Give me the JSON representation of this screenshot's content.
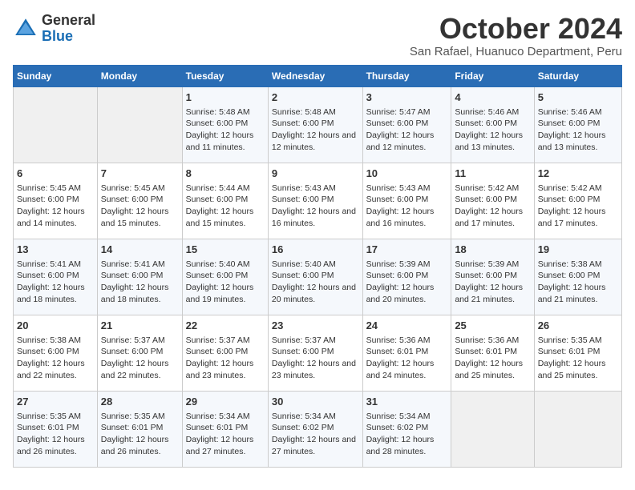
{
  "logo": {
    "general": "General",
    "blue": "Blue"
  },
  "title": "October 2024",
  "subtitle": "San Rafael, Huanuco Department, Peru",
  "days_of_week": [
    "Sunday",
    "Monday",
    "Tuesday",
    "Wednesday",
    "Thursday",
    "Friday",
    "Saturday"
  ],
  "weeks": [
    [
      {
        "day": "",
        "sunrise": "",
        "sunset": "",
        "daylight": ""
      },
      {
        "day": "",
        "sunrise": "",
        "sunset": "",
        "daylight": ""
      },
      {
        "day": "1",
        "sunrise": "Sunrise: 5:48 AM",
        "sunset": "Sunset: 6:00 PM",
        "daylight": "Daylight: 12 hours and 11 minutes."
      },
      {
        "day": "2",
        "sunrise": "Sunrise: 5:48 AM",
        "sunset": "Sunset: 6:00 PM",
        "daylight": "Daylight: 12 hours and 12 minutes."
      },
      {
        "day": "3",
        "sunrise": "Sunrise: 5:47 AM",
        "sunset": "Sunset: 6:00 PM",
        "daylight": "Daylight: 12 hours and 12 minutes."
      },
      {
        "day": "4",
        "sunrise": "Sunrise: 5:46 AM",
        "sunset": "Sunset: 6:00 PM",
        "daylight": "Daylight: 12 hours and 13 minutes."
      },
      {
        "day": "5",
        "sunrise": "Sunrise: 5:46 AM",
        "sunset": "Sunset: 6:00 PM",
        "daylight": "Daylight: 12 hours and 13 minutes."
      }
    ],
    [
      {
        "day": "6",
        "sunrise": "Sunrise: 5:45 AM",
        "sunset": "Sunset: 6:00 PM",
        "daylight": "Daylight: 12 hours and 14 minutes."
      },
      {
        "day": "7",
        "sunrise": "Sunrise: 5:45 AM",
        "sunset": "Sunset: 6:00 PM",
        "daylight": "Daylight: 12 hours and 15 minutes."
      },
      {
        "day": "8",
        "sunrise": "Sunrise: 5:44 AM",
        "sunset": "Sunset: 6:00 PM",
        "daylight": "Daylight: 12 hours and 15 minutes."
      },
      {
        "day": "9",
        "sunrise": "Sunrise: 5:43 AM",
        "sunset": "Sunset: 6:00 PM",
        "daylight": "Daylight: 12 hours and 16 minutes."
      },
      {
        "day": "10",
        "sunrise": "Sunrise: 5:43 AM",
        "sunset": "Sunset: 6:00 PM",
        "daylight": "Daylight: 12 hours and 16 minutes."
      },
      {
        "day": "11",
        "sunrise": "Sunrise: 5:42 AM",
        "sunset": "Sunset: 6:00 PM",
        "daylight": "Daylight: 12 hours and 17 minutes."
      },
      {
        "day": "12",
        "sunrise": "Sunrise: 5:42 AM",
        "sunset": "Sunset: 6:00 PM",
        "daylight": "Daylight: 12 hours and 17 minutes."
      }
    ],
    [
      {
        "day": "13",
        "sunrise": "Sunrise: 5:41 AM",
        "sunset": "Sunset: 6:00 PM",
        "daylight": "Daylight: 12 hours and 18 minutes."
      },
      {
        "day": "14",
        "sunrise": "Sunrise: 5:41 AM",
        "sunset": "Sunset: 6:00 PM",
        "daylight": "Daylight: 12 hours and 18 minutes."
      },
      {
        "day": "15",
        "sunrise": "Sunrise: 5:40 AM",
        "sunset": "Sunset: 6:00 PM",
        "daylight": "Daylight: 12 hours and 19 minutes."
      },
      {
        "day": "16",
        "sunrise": "Sunrise: 5:40 AM",
        "sunset": "Sunset: 6:00 PM",
        "daylight": "Daylight: 12 hours and 20 minutes."
      },
      {
        "day": "17",
        "sunrise": "Sunrise: 5:39 AM",
        "sunset": "Sunset: 6:00 PM",
        "daylight": "Daylight: 12 hours and 20 minutes."
      },
      {
        "day": "18",
        "sunrise": "Sunrise: 5:39 AM",
        "sunset": "Sunset: 6:00 PM",
        "daylight": "Daylight: 12 hours and 21 minutes."
      },
      {
        "day": "19",
        "sunrise": "Sunrise: 5:38 AM",
        "sunset": "Sunset: 6:00 PM",
        "daylight": "Daylight: 12 hours and 21 minutes."
      }
    ],
    [
      {
        "day": "20",
        "sunrise": "Sunrise: 5:38 AM",
        "sunset": "Sunset: 6:00 PM",
        "daylight": "Daylight: 12 hours and 22 minutes."
      },
      {
        "day": "21",
        "sunrise": "Sunrise: 5:37 AM",
        "sunset": "Sunset: 6:00 PM",
        "daylight": "Daylight: 12 hours and 22 minutes."
      },
      {
        "day": "22",
        "sunrise": "Sunrise: 5:37 AM",
        "sunset": "Sunset: 6:00 PM",
        "daylight": "Daylight: 12 hours and 23 minutes."
      },
      {
        "day": "23",
        "sunrise": "Sunrise: 5:37 AM",
        "sunset": "Sunset: 6:00 PM",
        "daylight": "Daylight: 12 hours and 23 minutes."
      },
      {
        "day": "24",
        "sunrise": "Sunrise: 5:36 AM",
        "sunset": "Sunset: 6:01 PM",
        "daylight": "Daylight: 12 hours and 24 minutes."
      },
      {
        "day": "25",
        "sunrise": "Sunrise: 5:36 AM",
        "sunset": "Sunset: 6:01 PM",
        "daylight": "Daylight: 12 hours and 25 minutes."
      },
      {
        "day": "26",
        "sunrise": "Sunrise: 5:35 AM",
        "sunset": "Sunset: 6:01 PM",
        "daylight": "Daylight: 12 hours and 25 minutes."
      }
    ],
    [
      {
        "day": "27",
        "sunrise": "Sunrise: 5:35 AM",
        "sunset": "Sunset: 6:01 PM",
        "daylight": "Daylight: 12 hours and 26 minutes."
      },
      {
        "day": "28",
        "sunrise": "Sunrise: 5:35 AM",
        "sunset": "Sunset: 6:01 PM",
        "daylight": "Daylight: 12 hours and 26 minutes."
      },
      {
        "day": "29",
        "sunrise": "Sunrise: 5:34 AM",
        "sunset": "Sunset: 6:01 PM",
        "daylight": "Daylight: 12 hours and 27 minutes."
      },
      {
        "day": "30",
        "sunrise": "Sunrise: 5:34 AM",
        "sunset": "Sunset: 6:02 PM",
        "daylight": "Daylight: 12 hours and 27 minutes."
      },
      {
        "day": "31",
        "sunrise": "Sunrise: 5:34 AM",
        "sunset": "Sunset: 6:02 PM",
        "daylight": "Daylight: 12 hours and 28 minutes."
      },
      {
        "day": "",
        "sunrise": "",
        "sunset": "",
        "daylight": ""
      },
      {
        "day": "",
        "sunrise": "",
        "sunset": "",
        "daylight": ""
      }
    ]
  ]
}
